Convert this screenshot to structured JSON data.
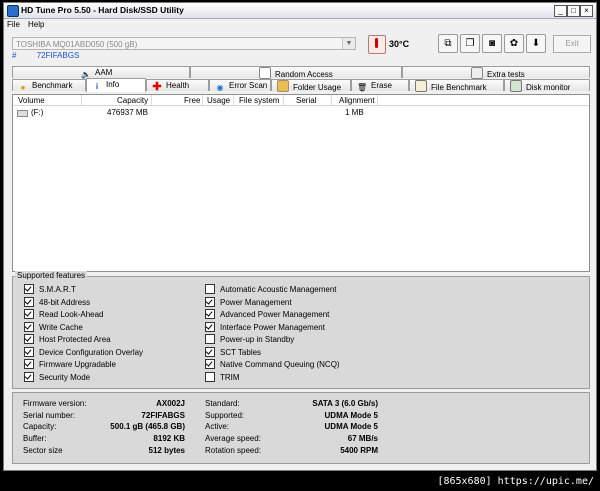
{
  "window": {
    "title": "HD Tune Pro 5.50 - Hard Disk/SSD Utility"
  },
  "menu": [
    "File",
    "Help"
  ],
  "drive": {
    "selected": "TOSHIBA MQ01ABD050 (500 gB)",
    "marker": "#",
    "serial": "72FIFABGS"
  },
  "temperature": "30°C",
  "toolbar": {
    "exit_label": "Exit"
  },
  "tabs_top": [
    "AAM",
    "Random Access",
    "Extra tests"
  ],
  "tabs_bottom": [
    "Benchmark",
    "Info",
    "Health",
    "Error Scan",
    "Folder Usage",
    "Erase",
    "File Benchmark",
    "Disk monitor"
  ],
  "active_tab": "Info",
  "volumes": {
    "headers": [
      "Volume",
      "Capacity",
      "Free",
      "Usage",
      "File system",
      "Serial",
      "Alignment"
    ],
    "rows": [
      {
        "volume": "(F:)",
        "capacity": "476937 MB",
        "free": "",
        "usage": "",
        "fs": "",
        "serial": "",
        "alignment": "1 MB"
      }
    ]
  },
  "features": {
    "legend": "Supported features",
    "left": [
      {
        "label": "S.M.A.R.T",
        "checked": true
      },
      {
        "label": "48-bit Address",
        "checked": true
      },
      {
        "label": "Read Look-Ahead",
        "checked": true
      },
      {
        "label": "Write Cache",
        "checked": true
      },
      {
        "label": "Host Protected Area",
        "checked": true
      },
      {
        "label": "Device Configuration Overlay",
        "checked": true
      },
      {
        "label": "Firmware Upgradable",
        "checked": true
      },
      {
        "label": "Security Mode",
        "checked": true
      }
    ],
    "right": [
      {
        "label": "Automatic Acoustic Management",
        "checked": false
      },
      {
        "label": "Power Management",
        "checked": true
      },
      {
        "label": "Advanced Power Management",
        "checked": true
      },
      {
        "label": "Interface Power Management",
        "checked": true
      },
      {
        "label": "Power-up in Standby",
        "checked": false
      },
      {
        "label": "SCT Tables",
        "checked": true
      },
      {
        "label": "Native Command Queuing (NCQ)",
        "checked": true
      },
      {
        "label": "TRIM",
        "checked": false
      }
    ]
  },
  "info": {
    "left": [
      {
        "label": "Firmware version:",
        "value": "AX002J"
      },
      {
        "label": "Serial number:",
        "value": "72FIFABGS"
      },
      {
        "label": "Capacity:",
        "value": "500.1 gB (465.8 GB)"
      },
      {
        "label": "Buffer:",
        "value": "8192 KB"
      },
      {
        "label": "Sector size",
        "value": "512 bytes"
      }
    ],
    "right": [
      {
        "label": "Standard:",
        "value": "SATA 3 (6.0 Gb/s)"
      },
      {
        "label": "Supported:",
        "value": "UDMA Mode 5"
      },
      {
        "label": "Active:",
        "value": "UDMA Mode 5"
      },
      {
        "label": "Average speed:",
        "value": "67 MB/s"
      },
      {
        "label": "Rotation speed:",
        "value": "5400 RPM"
      }
    ]
  },
  "watermark": "[865x680] https://upic.me/"
}
